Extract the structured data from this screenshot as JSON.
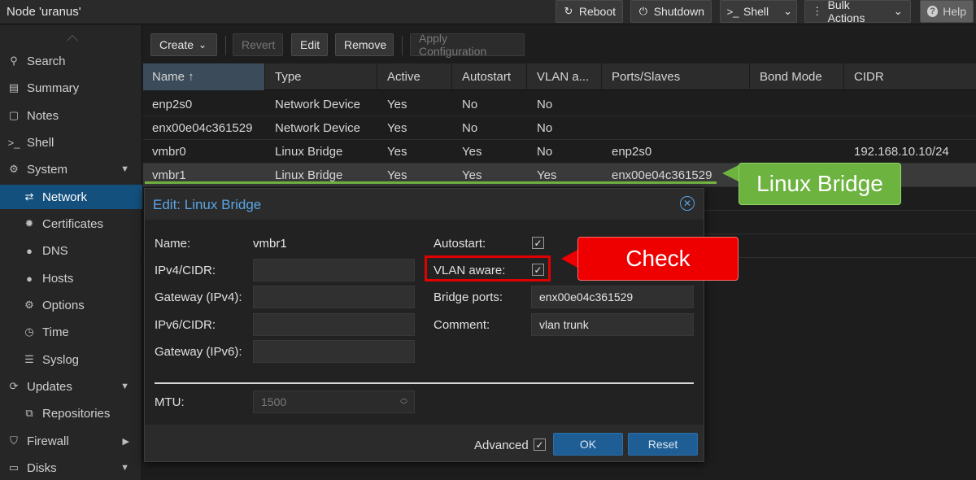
{
  "topbar": {
    "title": "Node 'uranus'",
    "buttons": {
      "reboot": "Reboot",
      "shutdown": "Shutdown",
      "shell": "Shell",
      "bulk_actions": "Bulk Actions",
      "help": "Help"
    }
  },
  "sidebar": {
    "items": [
      {
        "label": "Search",
        "icon": "search-icon"
      },
      {
        "label": "Summary",
        "icon": "book-icon"
      },
      {
        "label": "Notes",
        "icon": "note-icon"
      },
      {
        "label": "Shell",
        "icon": "terminal-icon"
      },
      {
        "label": "System",
        "icon": "gears-icon"
      },
      {
        "label": "Network",
        "icon": "exchange-icon"
      },
      {
        "label": "Certificates",
        "icon": "certificate-icon"
      },
      {
        "label": "DNS",
        "icon": "globe-icon"
      },
      {
        "label": "Hosts",
        "icon": "globe-icon"
      },
      {
        "label": "Options",
        "icon": "gear-icon"
      },
      {
        "label": "Time",
        "icon": "clock-icon"
      },
      {
        "label": "Syslog",
        "icon": "list-icon"
      },
      {
        "label": "Updates",
        "icon": "refresh-icon"
      },
      {
        "label": "Repositories",
        "icon": "files-icon"
      },
      {
        "label": "Firewall",
        "icon": "shield-icon"
      },
      {
        "label": "Disks",
        "icon": "hdd-icon"
      }
    ]
  },
  "toolbar": {
    "create": "Create",
    "revert": "Revert",
    "edit": "Edit",
    "remove": "Remove",
    "apply": "Apply Configuration"
  },
  "grid": {
    "columns": [
      "Name ↑",
      "Type",
      "Active",
      "Autostart",
      "VLAN a...",
      "Ports/Slaves",
      "Bond Mode",
      "CIDR"
    ],
    "rows": [
      {
        "name": "enp2s0",
        "type": "Network Device",
        "active": "Yes",
        "autostart": "No",
        "vlan": "No",
        "ports": "",
        "bond": "",
        "cidr": ""
      },
      {
        "name": "enx00e04c361529",
        "type": "Network Device",
        "active": "Yes",
        "autostart": "No",
        "vlan": "No",
        "ports": "",
        "bond": "",
        "cidr": ""
      },
      {
        "name": "vmbr0",
        "type": "Linux Bridge",
        "active": "Yes",
        "autostart": "Yes",
        "vlan": "No",
        "ports": "enp2s0",
        "bond": "",
        "cidr": "192.168.10.10/24"
      },
      {
        "name": "vmbr1",
        "type": "Linux Bridge",
        "active": "Yes",
        "autostart": "Yes",
        "vlan": "Yes",
        "ports": "enx00e04c361529",
        "bond": "",
        "cidr": ""
      }
    ]
  },
  "dialog": {
    "title": "Edit: Linux Bridge",
    "labels": {
      "name": "Name:",
      "ipv4": "IPv4/CIDR:",
      "gw4": "Gateway (IPv4):",
      "ipv6": "IPv6/CIDR:",
      "gw6": "Gateway (IPv6):",
      "autostart": "Autostart:",
      "vlan_aware": "VLAN aware:",
      "bridge_ports": "Bridge ports:",
      "comment": "Comment:",
      "mtu": "MTU:",
      "advanced": "Advanced"
    },
    "values": {
      "name": "vmbr1",
      "ipv4": "",
      "gw4": "",
      "ipv6": "",
      "gw6": "",
      "bridge_ports": "enx00e04c361529",
      "comment": "vlan trunk",
      "mtu_placeholder": "1500"
    },
    "buttons": {
      "ok": "OK",
      "reset": "Reset"
    }
  },
  "annotations": {
    "check": "Check",
    "linux_bridge": "Linux Bridge"
  }
}
